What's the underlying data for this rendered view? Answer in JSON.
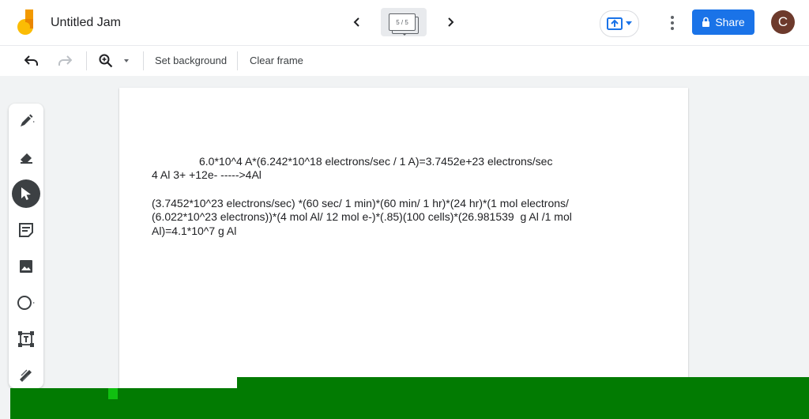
{
  "header": {
    "title": "Untitled Jam",
    "frame_indicator": "5 / 5",
    "share_label": "Share",
    "avatar_letter": "C"
  },
  "toolbar": {
    "set_background": "Set background",
    "clear_frame": "Clear frame"
  },
  "palette": {
    "tools": [
      "pen",
      "eraser",
      "select",
      "sticky-note",
      "image",
      "circle",
      "text-box",
      "laser"
    ],
    "active": "select"
  },
  "canvas": {
    "line1": "6.0*10^4 A*(6.242*10^18 electrons/sec / 1 A)=3.7452e+23 electrons/sec",
    "line2": "4 Al 3+ +12e- ----->4Al",
    "line3": "(3.7452*10^23 electrons/sec) *(60 sec/ 1 min)*(60 min/ 1 hr)*(24 hr)*(1 mol electrons/",
    "line4": "(6.022*10^23 electrons))*(4 mol Al/ 12 mol e-)*(.85)(100 cells)*(26.981539  g Al /1 mol",
    "line5": "Al)=4.1*10^7 g Al"
  },
  "colors": {
    "accent": "#1a73e8",
    "avatar": "#6d3a2c",
    "green_overlay": "#027b02"
  }
}
